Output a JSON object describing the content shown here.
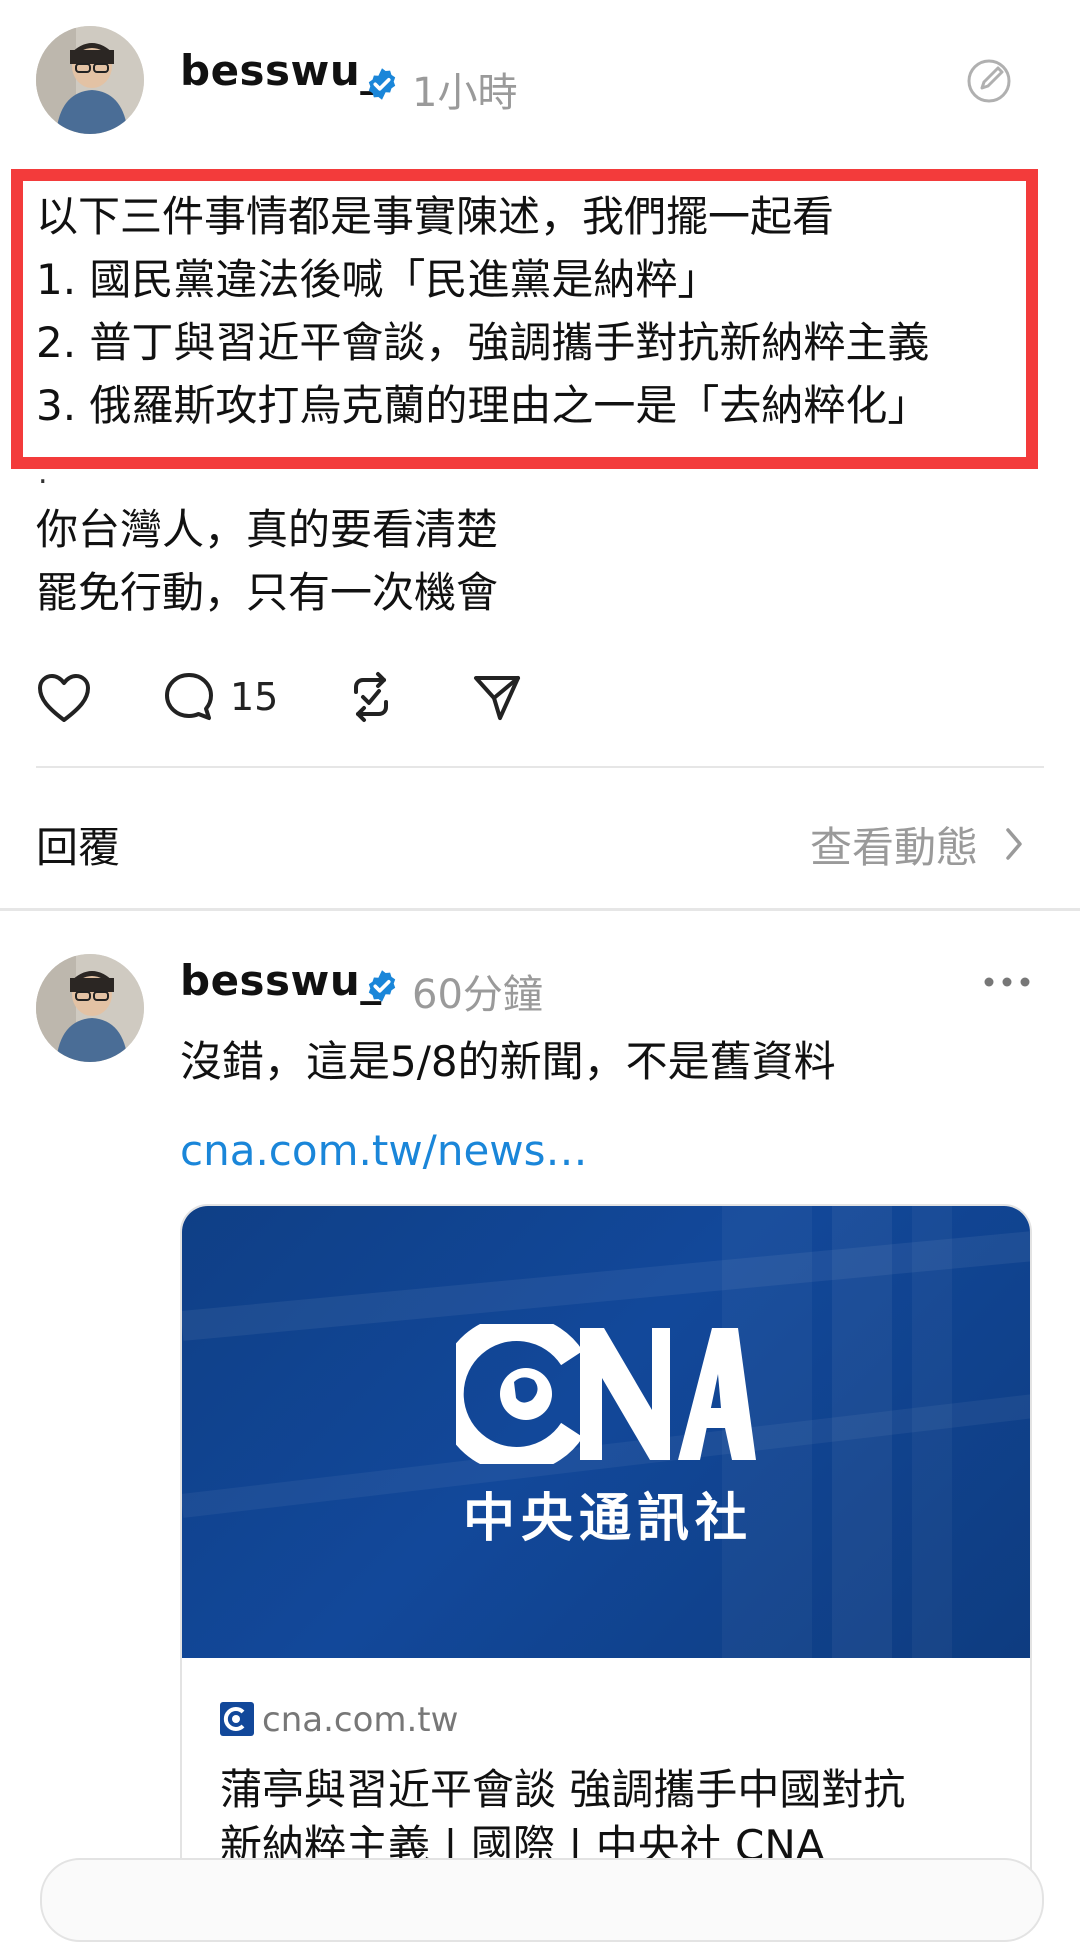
{
  "post1": {
    "username": "besswu_",
    "time": "1小時",
    "highlighted_lines": [
      "以下三件事情都是事實陳述，我們擺一起看",
      "1. 國民黨違法後喊「民進黨是納粹」",
      "2. 普丁與習近平會談，強調攜手對抗新納粹主義",
      "3. 俄羅斯攻打烏克蘭的理由之一是「去納粹化」"
    ],
    "separator": ".",
    "lines": [
      "你台灣人，真的要看清楚",
      "罷免行動，只有一次機會"
    ],
    "comment_count": "15"
  },
  "reply_bar": {
    "label": "回覆",
    "activity_label": "查看動態",
    "chevron": ">"
  },
  "post2": {
    "username": "besswu_",
    "time": "60分鐘",
    "text": "沒錯，這是5/8的新聞，不是舊資料",
    "link": "cna.com.tw/news…",
    "card": {
      "image_caption": "中央通訊社",
      "domain": "cna.com.tw",
      "title_line1": "蒲亭與習近平會談 強調攜手中國對抗",
      "title_line2": "新納粹主義 | 國際 | 中央社 CNA"
    }
  },
  "colors": {
    "highlight": "#f33b3b",
    "link": "#1a86d9",
    "verified": "#1a86d9",
    "cna_blue": "#12489a"
  },
  "icons": [
    "edit-circle-icon",
    "heart-icon",
    "comment-icon",
    "repost-icon",
    "share-icon",
    "more-icon",
    "verified-icon",
    "chevron-right-icon",
    "cna-logo-icon"
  ]
}
